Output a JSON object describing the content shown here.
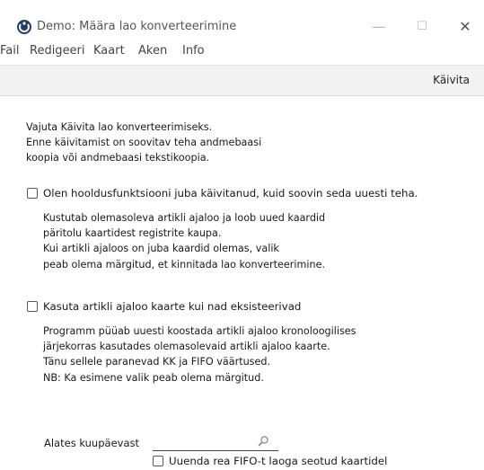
{
  "window": {
    "title": "Demo: Määra lao konverteerimine",
    "controls": [
      "—",
      "☐",
      "✕"
    ]
  },
  "menu": [
    "Fail",
    "Redigeeri",
    "Kaart",
    "Aken",
    "Info"
  ],
  "toolbar": {
    "run_label": "Käivita"
  },
  "intro": [
    "Vajuta Käivita lao konverteerimiseks.",
    "Enne käivitamist on soovitav teha andmebaasi",
    "koopia või andmebaasi tekstikoopia."
  ],
  "option1": {
    "label": "Olen hooldusfunktsiooni juba käivitanud, kuid soovin seda uuesti teha.",
    "checked": false,
    "description": [
      "Kustutab olemasoleva artikli ajaloo ja loob uued kaardid",
      "päritolu kaartidest registrite kaupa.",
      "Kui artikli ajaloos on juba kaardid olemas, valik",
      "peab olema märgitud, et kinnitada lao konverteerimine."
    ]
  },
  "option2": {
    "label": "Kasuta artikli ajaloo kaarte kui nad eksisteerivad",
    "checked": false,
    "description": [
      "Programm püüab uuesti koostada artikli ajaloo kronoloogilises",
      "järjekorras kasutades olemasolevaid artikli ajaloo kaarte.",
      "Tänu sellele paranevad KK ja FIFO väärtused.",
      "NB: Ka esimene valik peab olema märgitud."
    ]
  },
  "date_from": {
    "label": "Alates kuupäevast",
    "value": ""
  },
  "option3": {
    "label": "Uuenda rea FIFO-t laoga seotud kaartidel",
    "checked": false
  },
  "icons": {
    "app": "app-logo-icon",
    "lookup": "magnifier-icon"
  }
}
